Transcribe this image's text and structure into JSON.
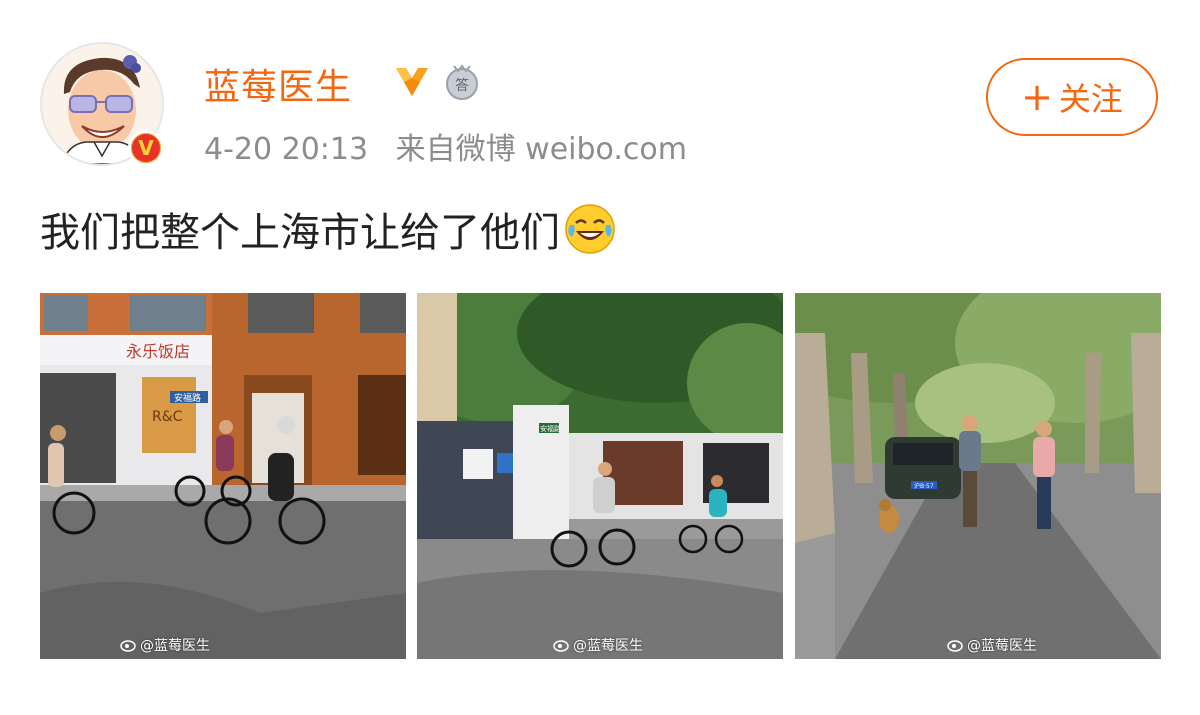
{
  "user": {
    "name": "蓝莓医生",
    "verified_mark": "V"
  },
  "post": {
    "time": "4-20 20:13",
    "source": "来自微博 weibo.com",
    "text": "我们把整个上海市让给了他们",
    "emoji": "laughing-crying-emoji"
  },
  "follow": {
    "plus": "+",
    "label": "关注"
  },
  "photos": [
    {
      "shop_sign": "永乐饭店",
      "sign_box": "R&C",
      "street_sign": "安福路",
      "watermark": "@蓝莓医生"
    },
    {
      "street_sign": "安福路",
      "watermark": "@蓝莓医生"
    },
    {
      "plate": "沪B·57",
      "watermark": "@蓝莓医生"
    }
  ],
  "colors": {
    "accent": "#f2670f",
    "meta": "#8c8c8c",
    "badge_red": "#e8332a"
  }
}
